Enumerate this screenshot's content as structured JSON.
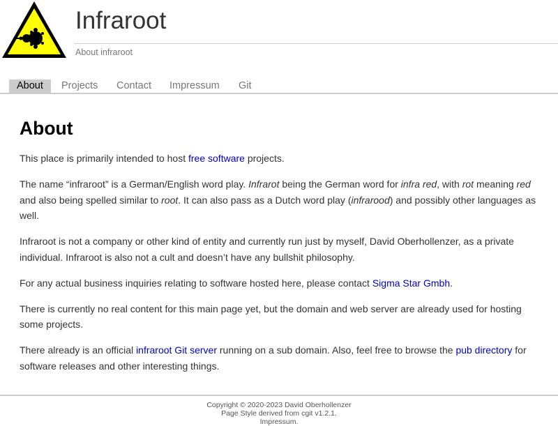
{
  "header": {
    "title": "Infraroot",
    "subtitle": "About infraroot"
  },
  "nav": {
    "items": [
      {
        "label": "About",
        "active": true
      },
      {
        "label": "Projects"
      },
      {
        "label": "Contact"
      },
      {
        "label": "Impressum"
      },
      {
        "label": "Git"
      }
    ]
  },
  "content": {
    "heading": "About",
    "p1": {
      "before": "This place is primarily intended to host ",
      "link": "free software",
      "after": " projects."
    },
    "p2": {
      "t1": "The name “infraroot” is a German/English word play. ",
      "e1": "Infrarot",
      "t2": " being the German word for ",
      "e2": "infra red",
      "t3": ", with ",
      "e3": "rot",
      "t4": " meaning ",
      "e4": "red",
      "t5": " and also being spelled similar to ",
      "e5": "root",
      "t6": ". It can also pass as a Dutch word play (",
      "e6": "infrarood",
      "t7": ") and possibly other languages as well."
    },
    "p3": "Infraroot is not a company or other kind of entity and currently run just by myself, David Oberhollenzer, as a private individual. Infraroot is also not a cult and doesn’t have any bullshit philosophy.",
    "p4": {
      "before": "For any actual business inquiries relating to software hosted here, please contact ",
      "link": "Sigma Star Gmbh",
      "after": "."
    },
    "p5": "There is currently no real content for this main page yet, but the domain and web server are already used for hosting some projects.",
    "p6": {
      "t1": "There already is an official ",
      "link1": "infraroot Git server",
      "t2": " running on a sub domain. Also, feel free to browse the ",
      "link2": "pub directory",
      "t3": " for software releases and other interesting things."
    }
  },
  "footer": {
    "line1": "Copyright © 2020-2023 David Oberhollenzer",
    "line2": "Page Style derived from cgit v1.2.1.",
    "line3": "Impressum."
  },
  "colors": {
    "logo_yellow": "#ffff00",
    "link": "#0000cc",
    "nav_active_bg": "#cccccc"
  },
  "icons": {
    "logo": "mandelbrot-warning-sign-icon"
  }
}
